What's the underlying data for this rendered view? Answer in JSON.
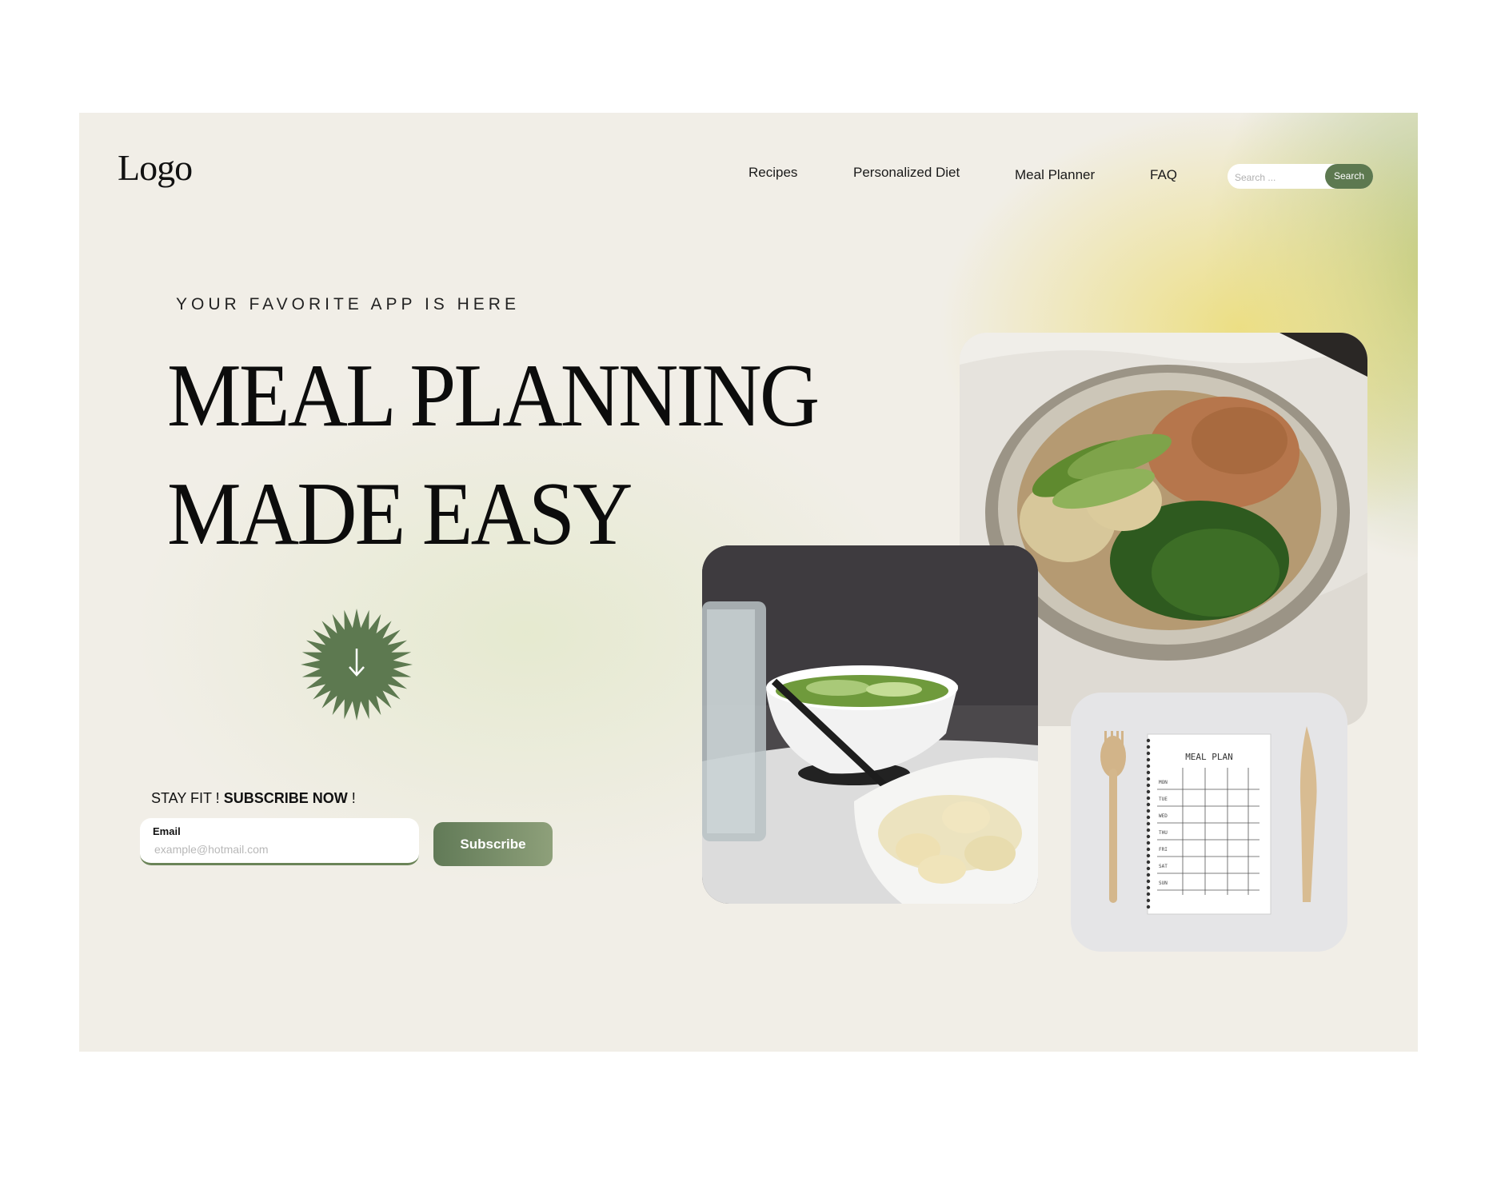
{
  "header": {
    "logo": "Logo",
    "nav": [
      "Recipes",
      "Personalized Diet",
      "Meal Planner",
      "FAQ"
    ],
    "search": {
      "placeholder": "Search ...",
      "button_label": "Search"
    }
  },
  "hero": {
    "eyebrow": "YOUR FAVORITE APP IS HERE",
    "headline_line1": "MEAL PLANNING",
    "headline_line2": "MADE EASY",
    "scroll_icon": "arrow-down-icon"
  },
  "subscribe": {
    "lead": "STAY FIT !",
    "cta_text": "SUBSCRIBE NOW",
    "cta_suffix": " !",
    "email_label": "Email",
    "email_placeholder": "example@hotmail.com",
    "button_label": "Subscribe"
  },
  "gallery": {
    "notepad_title": "MEAL PLAN",
    "days": [
      "MON",
      "TUE",
      "WED",
      "THU",
      "FRI",
      "SAT",
      "SUN"
    ]
  },
  "colors": {
    "accent_green": "#5d7950",
    "background": "#f1eee7",
    "glow_yellow": "#ecde80"
  }
}
